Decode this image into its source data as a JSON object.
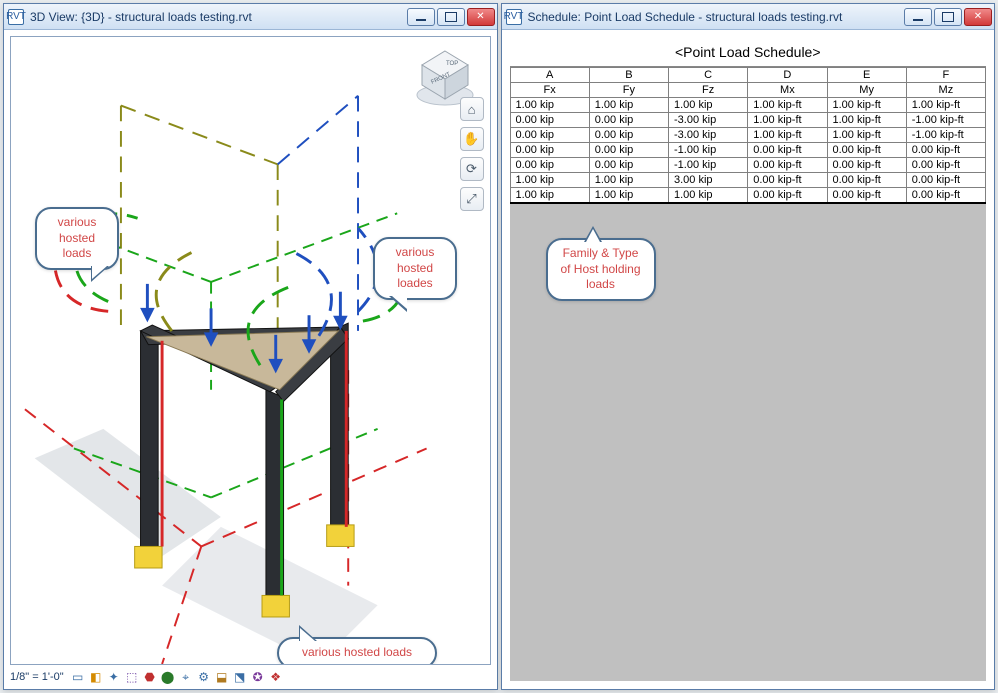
{
  "left_window": {
    "title": "3D View: {3D} - structural loads testing.rvt",
    "app_icon_label": "RVT",
    "scale_text": "1/8\" = 1'-0\"",
    "callouts": {
      "left": "various hosted loads",
      "right": "various hosted loades",
      "bottom": "various hosted loads"
    }
  },
  "right_window": {
    "title": "Schedule: Point Load Schedule - structural loads testing.rvt",
    "app_icon_label": "RVT",
    "schedule_title": "<Point Load Schedule>",
    "columns_letters": [
      "A",
      "B",
      "C",
      "D",
      "E",
      "F"
    ],
    "columns_labels": [
      "Fx",
      "Fy",
      "Fz",
      "Mx",
      "My",
      "Mz"
    ],
    "rows": [
      [
        "1.00 kip",
        "1.00 kip",
        "1.00 kip",
        "1.00 kip-ft",
        "1.00 kip-ft",
        "1.00 kip-ft"
      ],
      [
        "0.00 kip",
        "0.00 kip",
        "-3.00 kip",
        "1.00 kip-ft",
        "1.00 kip-ft",
        "-1.00 kip-ft"
      ],
      [
        "0.00 kip",
        "0.00 kip",
        "-3.00 kip",
        "1.00 kip-ft",
        "1.00 kip-ft",
        "-1.00 kip-ft"
      ],
      [
        "0.00 kip",
        "0.00 kip",
        "-1.00 kip",
        "0.00 kip-ft",
        "0.00 kip-ft",
        "0.00 kip-ft"
      ],
      [
        "0.00 kip",
        "0.00 kip",
        "-1.00 kip",
        "0.00 kip-ft",
        "0.00 kip-ft",
        "0.00 kip-ft"
      ],
      [
        "1.00 kip",
        "1.00 kip",
        "3.00 kip",
        "0.00 kip-ft",
        "0.00 kip-ft",
        "0.00 kip-ft"
      ],
      [
        "1.00 kip",
        "1.00 kip",
        "1.00 kip",
        "0.00 kip-ft",
        "0.00 kip-ft",
        "0.00 kip-ft"
      ]
    ],
    "callout": "Family & Type of Host holding loads"
  },
  "icons": {
    "minimize": "minimize",
    "maximize": "maximize",
    "close": "close",
    "home": "home",
    "hand": "hand",
    "rotate": "rotate",
    "zoom": "zoom-region"
  },
  "chart_data": {
    "type": "table",
    "title": "<Point Load Schedule>",
    "columns": [
      "Fx",
      "Fy",
      "Fz",
      "Mx",
      "My",
      "Mz"
    ],
    "units": [
      "kip",
      "kip",
      "kip",
      "kip-ft",
      "kip-ft",
      "kip-ft"
    ],
    "values": [
      [
        1.0,
        1.0,
        1.0,
        1.0,
        1.0,
        1.0
      ],
      [
        0.0,
        0.0,
        -3.0,
        1.0,
        1.0,
        -1.0
      ],
      [
        0.0,
        0.0,
        -3.0,
        1.0,
        1.0,
        -1.0
      ],
      [
        0.0,
        0.0,
        -1.0,
        0.0,
        0.0,
        0.0
      ],
      [
        0.0,
        0.0,
        -1.0,
        0.0,
        0.0,
        0.0
      ],
      [
        1.0,
        1.0,
        3.0,
        0.0,
        0.0,
        0.0
      ],
      [
        1.0,
        1.0,
        1.0,
        0.0,
        0.0,
        0.0
      ]
    ]
  }
}
